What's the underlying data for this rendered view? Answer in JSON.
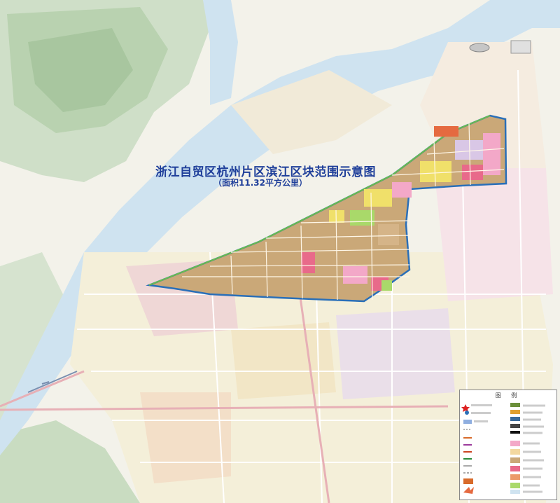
{
  "map": {
    "title": "浙江自贸区杭州片区滨江区块范围示意图",
    "subtitle": "（面积11.32平方公里）"
  },
  "legend": {
    "title": "图 例"
  },
  "colors": {
    "river": "#cfe3f0",
    "mountain": "#b9d3b3",
    "zone_fill": "#caa878",
    "zone_border": "#2a6fb8",
    "title": "#1f3f9a"
  }
}
